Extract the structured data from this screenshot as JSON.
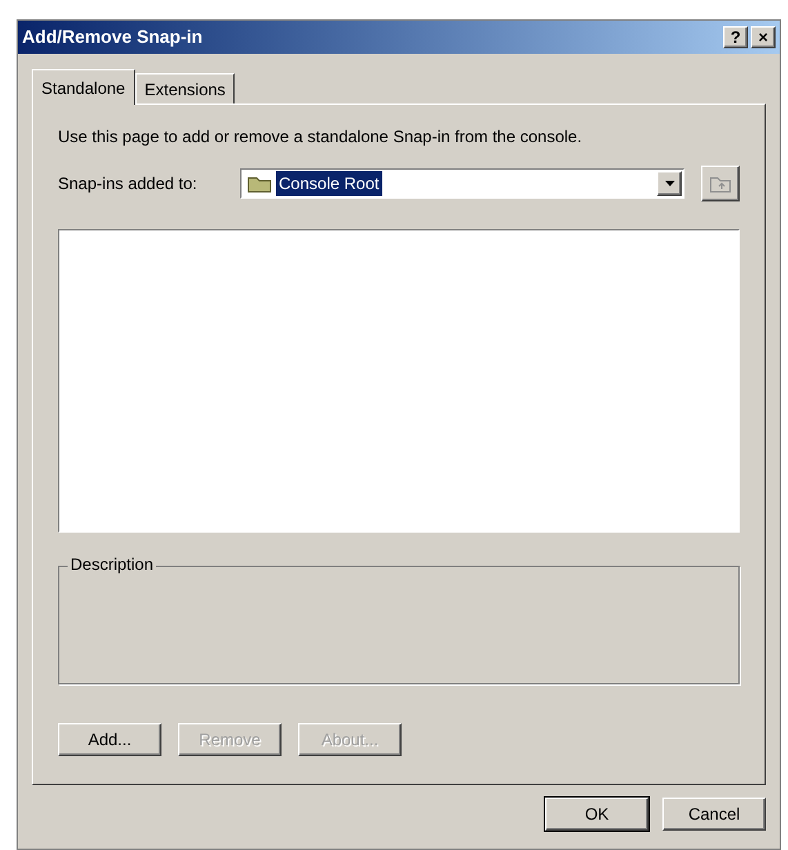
{
  "window": {
    "title": "Add/Remove Snap-in",
    "title_buttons": [
      "?",
      "×"
    ]
  },
  "tabs": [
    {
      "label": "Standalone",
      "selected": true
    },
    {
      "label": "Extensions",
      "selected": false
    }
  ],
  "intro": "Use this page to add or remove a standalone Snap-in from the console.",
  "snapins_added_to": {
    "label": "Snap-ins added to:",
    "value": "Console Root",
    "selected": true
  },
  "description": {
    "label": "Description"
  },
  "action_buttons": [
    {
      "label": "Add...",
      "disabled": false
    },
    {
      "label": "Remove",
      "disabled": true
    },
    {
      "label": "About...",
      "disabled": true
    }
  ],
  "dialog_buttons": [
    {
      "label": "OK",
      "default": true
    },
    {
      "label": "Cancel",
      "default": false
    }
  ]
}
